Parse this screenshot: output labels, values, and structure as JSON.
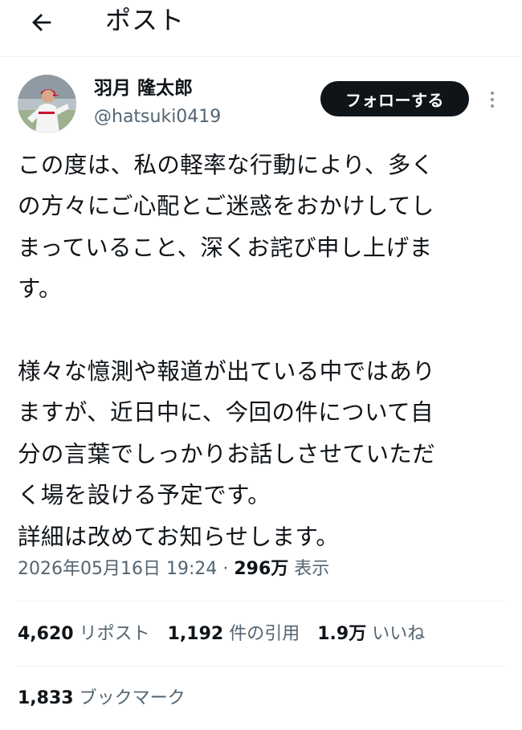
{
  "header": {
    "title": "ポスト",
    "back_icon": "arrow-left-icon"
  },
  "author": {
    "display_name": "羽月 隆太郎",
    "handle": "@hatsuki0419",
    "avatar": "baseball-player-avatar"
  },
  "follow_button": {
    "label": "フォローする"
  },
  "more_icon": "more-vertical-icon",
  "tweet": {
    "lines": [
      "この度は、私の軽率な行動により、多く",
      "の方々にご心配とご迷惑をおかけしてし",
      "まっていること、深くお詫び申し上げま",
      "す。",
      "",
      "様々な憶測や報道が出ている中ではあり",
      "ますが、近日中に、今回の件について自",
      "分の言葉でしっかりお話しさせていただ",
      "く場を設ける予定です。",
      "詳細は改めてお知らせします。"
    ]
  },
  "meta": {
    "timestamp": "2026年05月16日 19:24",
    "separator": " · ",
    "views_count": "296万",
    "views_label": " 表示"
  },
  "stats": {
    "reposts": {
      "count": "4,620",
      "label": "リポスト"
    },
    "quotes": {
      "count": "1,192",
      "label": "件の引用"
    },
    "likes": {
      "count": "1.9万",
      "label": "いいね"
    },
    "bookmarks": {
      "count": "1,833",
      "label": "ブックマーク"
    }
  },
  "colors": {
    "text": "#0f1419",
    "secondary": "#536471",
    "divider": "#eff3f4",
    "button_bg": "#0f1419"
  }
}
